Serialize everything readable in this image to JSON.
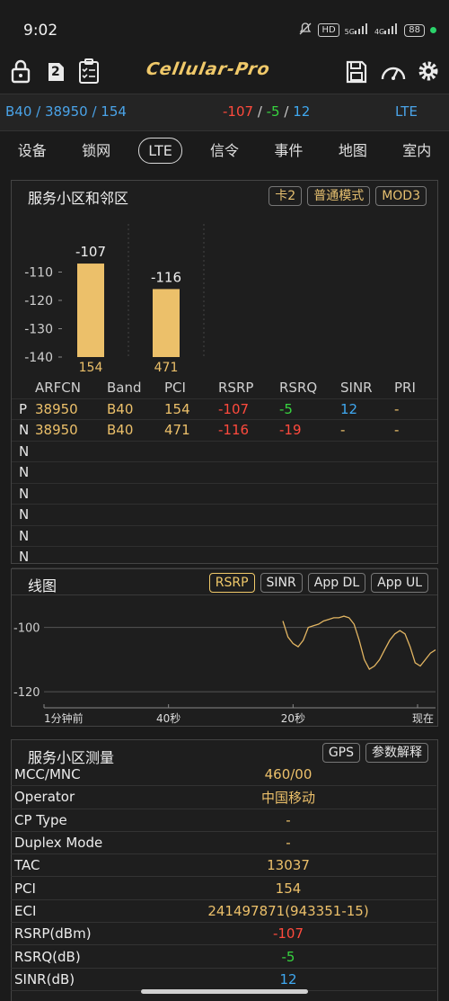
{
  "status": {
    "time": "9:02",
    "hd_badge": "HD",
    "net1": "5G",
    "net2": "4G",
    "battery": "88"
  },
  "toolbar": {
    "logo": "Cellular-Pro",
    "sim_badge": "2"
  },
  "infobar": {
    "cell": "B40 / 38950 / 154",
    "rsrp": "-107",
    "rsrq": "-5",
    "sinr": "12",
    "sep": " / ",
    "tech": "LTE"
  },
  "tabs": [
    "设备",
    "锁网",
    "LTE",
    "信令",
    "事件",
    "地图",
    "室内"
  ],
  "serving": {
    "title": "服务小区和邻区",
    "chips": [
      "卡2",
      "普通模式",
      "MOD3"
    ],
    "chart_data": {
      "type": "bar",
      "categories": [
        "154",
        "471"
      ],
      "values": [
        -107,
        -116
      ],
      "ylim": [
        -140,
        -100
      ],
      "yticks": [
        -110,
        -120,
        -130,
        -140
      ],
      "xlabel": "",
      "ylabel": ""
    },
    "table": {
      "headers": [
        "ARFCN",
        "Band",
        "PCI",
        "RSRP",
        "RSRQ",
        "SINR",
        "PRI"
      ],
      "rows": [
        {
          "type": "P",
          "arfcn": "38950",
          "band": "B40",
          "pci": "154",
          "rsrp": "-107",
          "rsrq": "-5",
          "sinr": "12",
          "pri": "-"
        },
        {
          "type": "N",
          "arfcn": "38950",
          "band": "B40",
          "pci": "471",
          "rsrp": "-116",
          "rsrq": "-19",
          "sinr": "-",
          "pri": "-"
        },
        {
          "type": "N"
        },
        {
          "type": "N"
        },
        {
          "type": "N"
        },
        {
          "type": "N"
        },
        {
          "type": "N"
        },
        {
          "type": "N"
        }
      ]
    }
  },
  "linechart": {
    "title": "线图",
    "chips": [
      "RSRP",
      "SINR",
      "App DL",
      "App UL"
    ],
    "chart_data": {
      "type": "line",
      "ylim": [
        -125,
        -92
      ],
      "yticks": [
        -100,
        -120
      ],
      "xticks": [
        "1分钟前",
        "40秒",
        "20秒",
        "现在"
      ],
      "series": [
        {
          "values": [
            -98,
            -103,
            -105,
            -106,
            -104,
            -100,
            -99.5,
            -99,
            -98,
            -97.5,
            -97,
            -97,
            -96.5,
            -97,
            -99,
            -104,
            -110,
            -113,
            -112,
            -110,
            -107,
            -104,
            -102,
            -101,
            -102,
            -106,
            -111,
            -112,
            -110,
            -108,
            -107
          ]
        }
      ]
    }
  },
  "measurement": {
    "title": "服务小区测量",
    "chips": [
      "GPS",
      "参数解释"
    ],
    "rows": [
      {
        "label": "MCC/MNC",
        "value": "460/00",
        "color": "yellow"
      },
      {
        "label": "Operator",
        "value": "中国移动",
        "color": "yellow"
      },
      {
        "label": "CP Type",
        "value": "-",
        "color": "yellow"
      },
      {
        "label": "Duplex Mode",
        "value": "-",
        "color": "yellow"
      },
      {
        "label": "TAC",
        "value": "13037",
        "color": "yellow"
      },
      {
        "label": "PCI",
        "value": "154",
        "color": "yellow"
      },
      {
        "label": "ECI",
        "value": "241497871(943351-15)",
        "color": "yellow"
      },
      {
        "label": "RSRP(dBm)",
        "value": "-107",
        "color": "red"
      },
      {
        "label": "RSRQ(dB)",
        "value": "-5",
        "color": "green"
      },
      {
        "label": "SINR(dB)",
        "value": "12",
        "color": "blue"
      }
    ]
  }
}
